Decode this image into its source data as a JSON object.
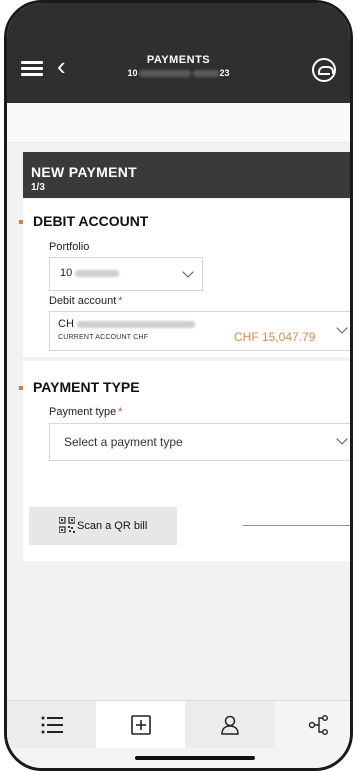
{
  "header": {
    "title": "PAYMENTS",
    "subtitle_prefix": "10",
    "subtitle_suffix": "23"
  },
  "form": {
    "title": "NEW PAYMENT",
    "step": "1/3"
  },
  "debit_section": {
    "title": "DEBIT ACCOUNT",
    "portfolio_label": "Portfolio",
    "portfolio_value_prefix": "10",
    "debit_label": "Debit account",
    "required_mark": "*",
    "account_prefix": "CH",
    "account_type": "CURRENT ACCOUNT CHF",
    "account_balance": "CHF 15,047.79"
  },
  "payment_section": {
    "title": "PAYMENT TYPE",
    "type_label": "Payment type",
    "required_mark": "*",
    "type_placeholder": "Select a payment type",
    "qr_button_label": "Scan a QR bill"
  },
  "tabs": [
    {
      "icon": "list-icon"
    },
    {
      "icon": "plus-square-icon"
    },
    {
      "icon": "contacts-icon"
    },
    {
      "icon": "share-icon"
    }
  ],
  "colors": {
    "accent": "#e07a2c",
    "header_bg": "#2f2f2f",
    "balance": "#e08a4a"
  }
}
